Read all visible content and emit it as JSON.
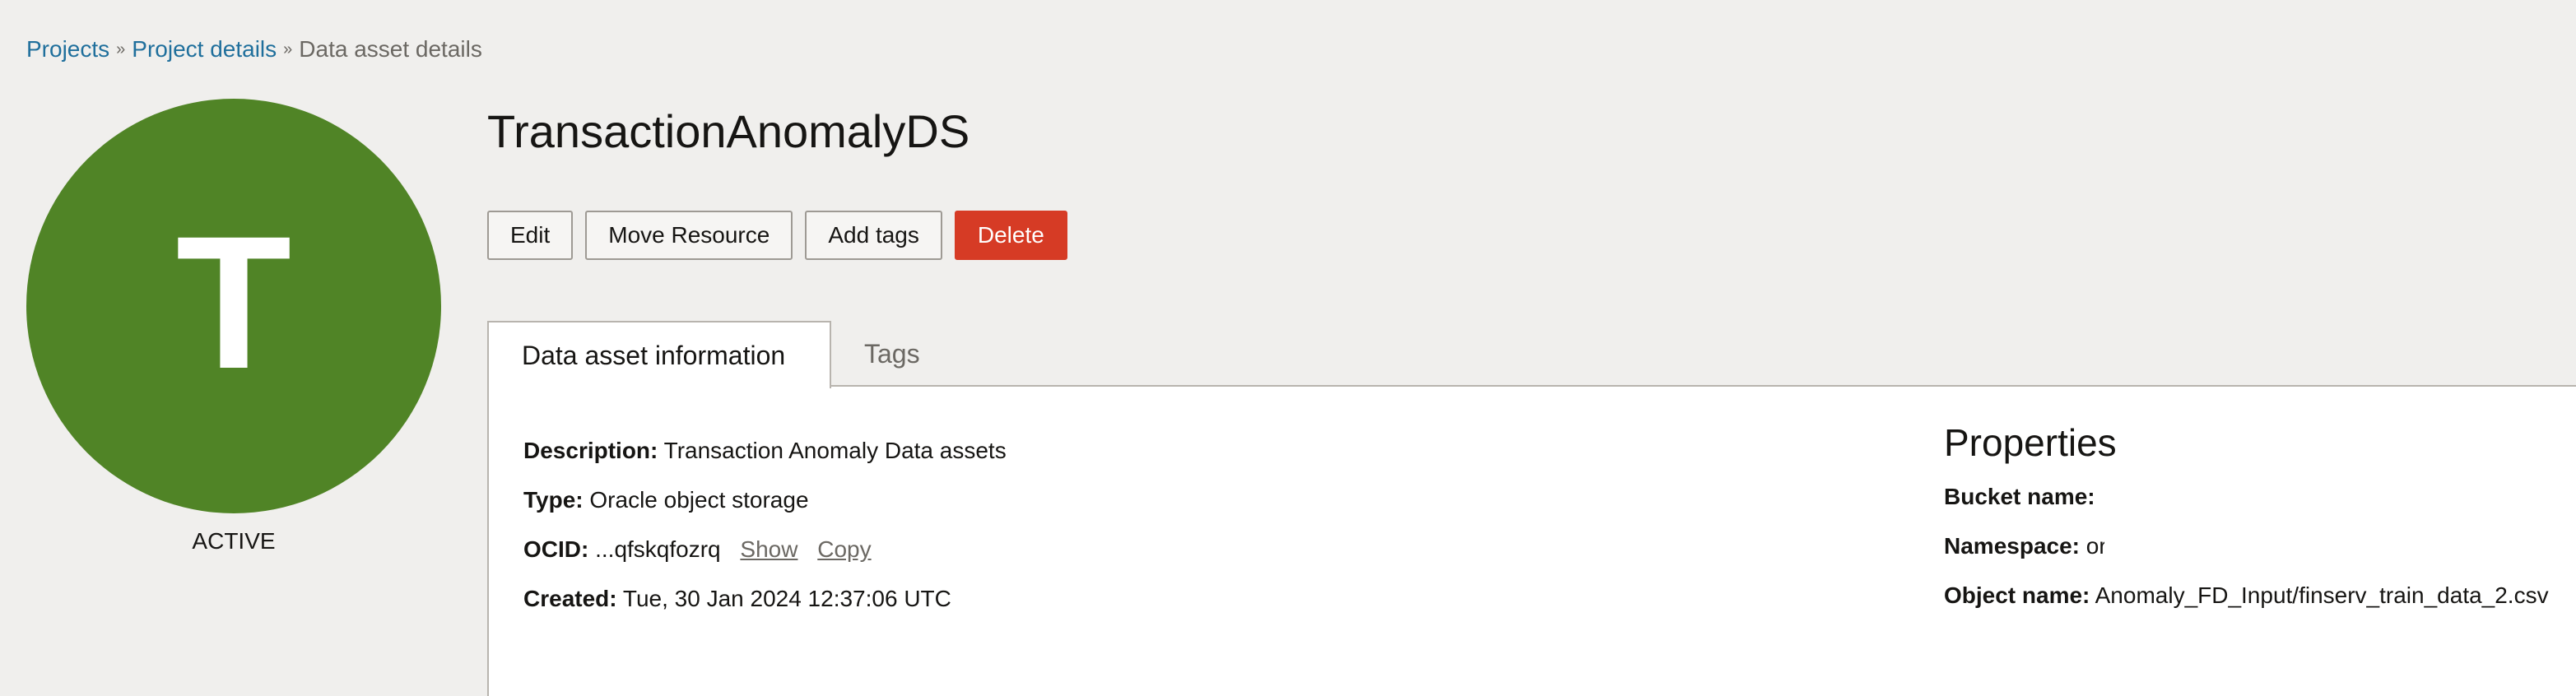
{
  "breadcrumb": {
    "items": [
      "Projects",
      "Project details"
    ],
    "current": "Data asset details",
    "separator": "»"
  },
  "avatar": {
    "letter": "T",
    "color": "#508426",
    "status": "ACTIVE"
  },
  "title": "TransactionAnomalyDS",
  "actions": {
    "edit": "Edit",
    "move": "Move Resource",
    "add_tags": "Add tags",
    "delete": "Delete"
  },
  "tabs": {
    "active": "Data asset information",
    "other": "Tags"
  },
  "info": {
    "description_label": "Description:",
    "description": "Transaction Anomaly Data assets",
    "type_label": "Type:",
    "type": "Oracle object storage",
    "ocid_label": "OCID:",
    "ocid": "...qfskqfozrq",
    "show": "Show",
    "copy": "Copy",
    "created_label": "Created:",
    "created": "Tue, 30 Jan 2024 12:37:06 UTC"
  },
  "properties": {
    "heading": "Properties",
    "bucket_label": "Bucket name:",
    "bucket": "",
    "namespace_label": "Namespace:",
    "namespace": "or",
    "object_label": "Object name:",
    "object": "Anomaly_FD_Input/finserv_train_data_2.csv"
  },
  "colors": {
    "link": "#1f6f9c",
    "danger": "#d63b25",
    "accent_green": "#508426"
  }
}
